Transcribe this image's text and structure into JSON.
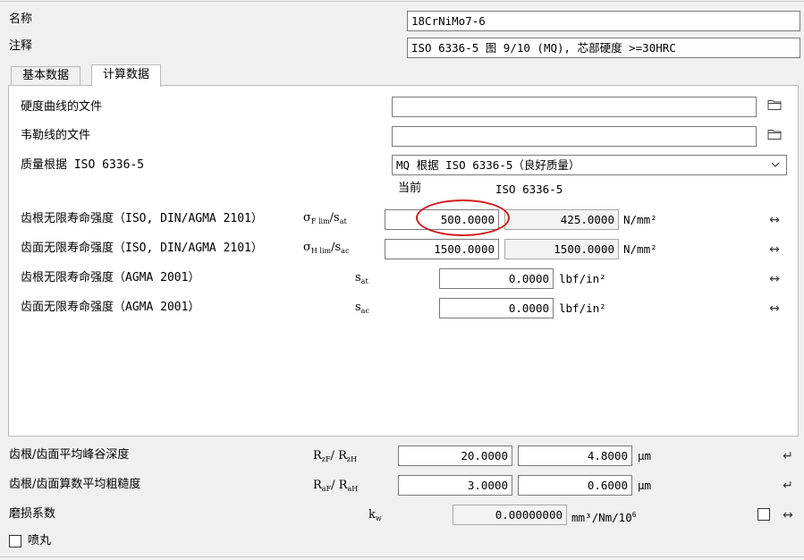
{
  "header": {
    "name_label": "名称",
    "name_value": "18CrNiMo7-6",
    "comment_label": "注释",
    "comment_value": "ISO 6336-5 图 9/10 (MQ), 芯部硬度 >=30HRC"
  },
  "tabs": [
    {
      "label": "基本数据"
    },
    {
      "label": "计算数据"
    }
  ],
  "files": {
    "hardness_label": "硬度曲线的文件",
    "hardness_value": "",
    "woehler_label": "韦勒线的文件",
    "woehler_value": ""
  },
  "quality": {
    "label": "质量根据 ISO 6336-5",
    "selected": "MQ 根据 ISO 6336-5（良好质量）"
  },
  "column_headers": {
    "current": "当前",
    "iso": "ISO 6336-5"
  },
  "strength_rows": [
    {
      "label": "齿根无限寿命强度（ISO, DIN/AGMA 2101）",
      "sym_main": "σ",
      "sym_sub": "F lim",
      "sym_sep": "/s",
      "sym_sub2": "at",
      "current": "500.0000",
      "iso": "425.0000",
      "unit": "N/mm²"
    },
    {
      "label": "齿面无限寿命强度（ISO, DIN/AGMA 2101）",
      "sym_main": "σ",
      "sym_sub": "H lim",
      "sym_sep": "/s",
      "sym_sub2": "ac",
      "current": "1500.0000",
      "iso": "1500.0000",
      "unit": "N/mm²"
    },
    {
      "label": "齿根无限寿命强度（AGMA 2001）",
      "sym_main": "s",
      "sym_sub": "at",
      "current": "0.0000",
      "unit": "lbf/in²"
    },
    {
      "label": "齿面无限寿命强度（AGMA 2001）",
      "sym_main": "s",
      "sym_sub": "ac",
      "current": "0.0000",
      "unit": "lbf/in²"
    }
  ],
  "roughness": [
    {
      "label": "齿根/齿面平均峰谷深度",
      "sym_a": "R",
      "sub_a": "zF",
      "sym_sep": "/ ",
      "sym_b": "R",
      "sub_b": "zH",
      "value_a": "20.0000",
      "value_b": "4.8000",
      "unit": "μm"
    },
    {
      "label": "齿根/齿面算数平均粗糙度",
      "sym_a": "R",
      "sub_a": "aF",
      "sym_sep": "/ ",
      "sym_b": "R",
      "sub_b": "aH",
      "value_a": "3.0000",
      "value_b": "0.6000",
      "unit": "μm"
    }
  ],
  "wear": {
    "label": "磨损系数",
    "sym": "k",
    "sub": "w",
    "value": "0.00000000",
    "unit": "mm³/Nm/10",
    "unit_sup": "6"
  },
  "shot_peening": {
    "label": "喷丸",
    "checked": false
  },
  "icons": {
    "folder": "folder-icon",
    "swap": "swap-arrows-icon",
    "enter": "enter-return-icon",
    "dropdown": "chevron-down-icon"
  }
}
